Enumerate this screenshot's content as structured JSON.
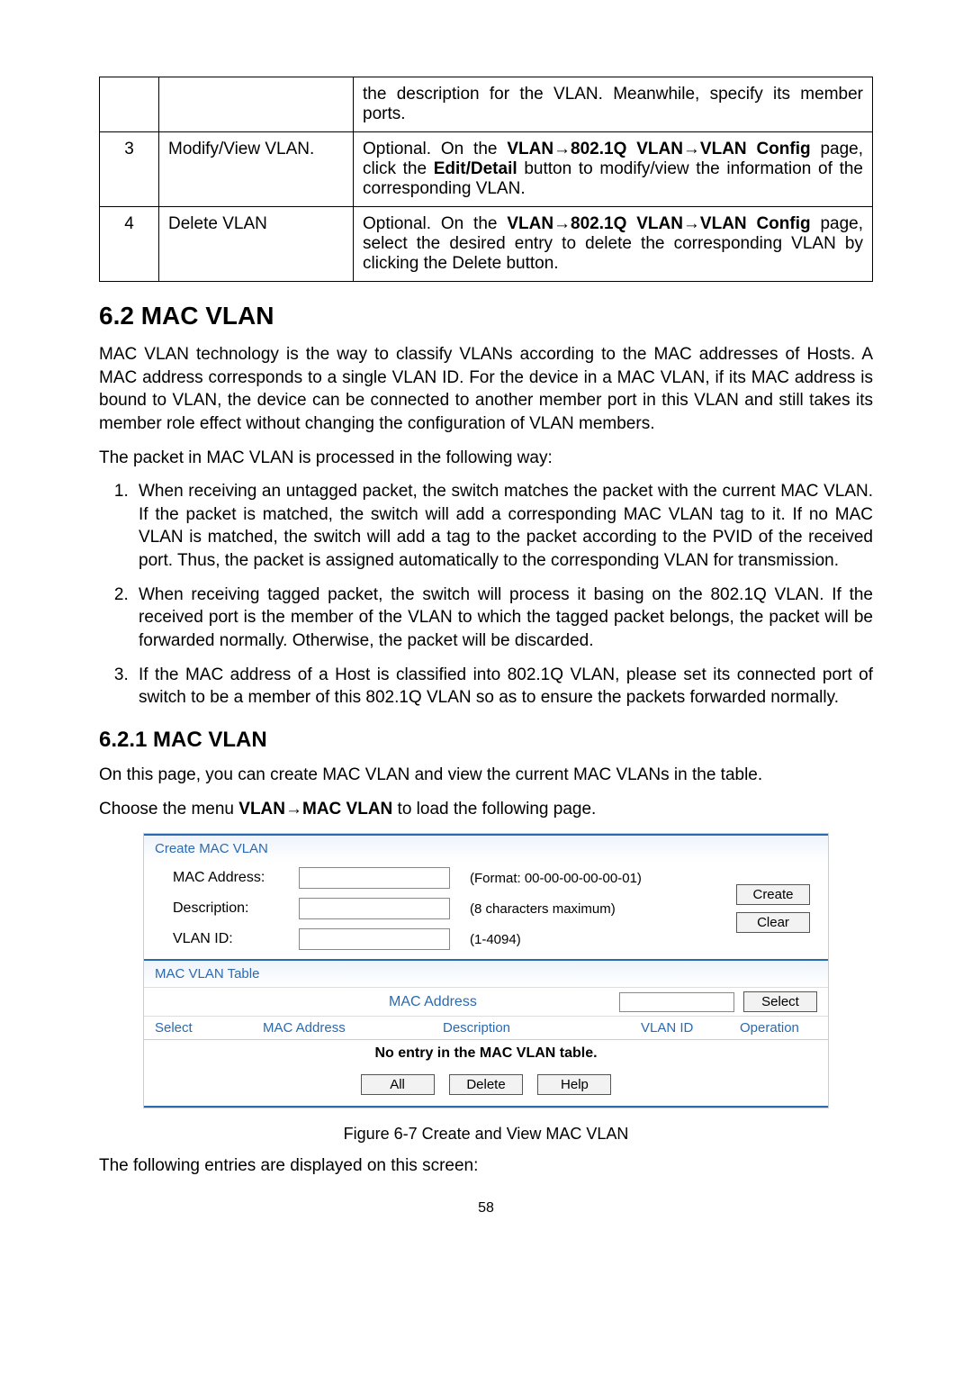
{
  "steps_table": {
    "row0": {
      "desc_cont": "the description for the VLAN. Meanwhile, specify its member ports."
    },
    "row3": {
      "num": "3",
      "label": "Modify/View VLAN.",
      "desc_a": "Optional. On the ",
      "desc_b": "VLAN→802.1Q VLAN→VLAN Config",
      "desc_c": " page, click the ",
      "desc_d": "Edit/Detail",
      "desc_e": " button to modify/view the information of the corresponding VLAN."
    },
    "row4": {
      "num": "4",
      "label": "Delete VLAN",
      "desc_a": "Optional. On the ",
      "desc_b": "VLAN→802.1Q VLAN→VLAN Config",
      "desc_c": " page, select the desired entry to delete the corresponding VLAN by clicking the Delete button."
    }
  },
  "section62": "6.2  MAC VLAN",
  "para1": "MAC VLAN technology is the way to classify VLANs according to the MAC addresses of Hosts. A MAC address corresponds to a single VLAN ID. For the device in a MAC VLAN, if its MAC address is bound to VLAN, the device can be connected to another member port in this VLAN and still takes its member role effect without changing the configuration of VLAN members.",
  "para2": "The packet in MAC VLAN is processed in the following way:",
  "list": {
    "i1": "When receiving an untagged packet, the switch matches the packet with the current MAC VLAN. If the packet is matched, the switch will add a corresponding MAC VLAN tag to it. If no MAC VLAN is matched, the switch will add a tag to the packet according to the PVID of the received port. Thus, the packet is assigned automatically to the corresponding VLAN for transmission.",
    "i2": "When receiving tagged packet, the switch will process it basing on the 802.1Q VLAN. If the received port is the member of the VLAN to which the tagged packet belongs, the packet will be forwarded normally. Otherwise, the packet will be discarded.",
    "i3": "If the MAC address of a Host is classified into 802.1Q VLAN, please set its connected port of switch to be a member of this 802.1Q VLAN so as to ensure the packets forwarded normally."
  },
  "subsection": "6.2.1 MAC VLAN",
  "para3": "On this page, you can create MAC VLAN and view the current MAC VLANs in the table.",
  "para4_a": "Choose the menu ",
  "para4_b": "VLAN→MAC VLAN",
  "para4_c": " to load the following page.",
  "panel": {
    "create_title": "Create MAC VLAN",
    "mac_label": "MAC Address:",
    "mac_hint": "(Format: 00-00-00-00-00-01)",
    "desc_label": "Description:",
    "desc_hint": "(8 characters maximum)",
    "vlan_label": "VLAN ID:",
    "vlan_hint": "(1-4094)",
    "create_btn": "Create",
    "clear_btn": "Clear",
    "table_title": "MAC VLAN Table",
    "search_label": "MAC Address",
    "select_btn": "Select",
    "col_select": "Select",
    "col_mac": "MAC Address",
    "col_desc": "Description",
    "col_vlan": "VLAN ID",
    "col_op": "Operation",
    "noentry": "No entry in the MAC VLAN table.",
    "all_btn": "All",
    "delete_btn": "Delete",
    "help_btn": "Help"
  },
  "fig_caption": "Figure 6-7 Create and View MAC VLAN",
  "closing": "The following entries are displayed on this screen:",
  "page_number": "58"
}
